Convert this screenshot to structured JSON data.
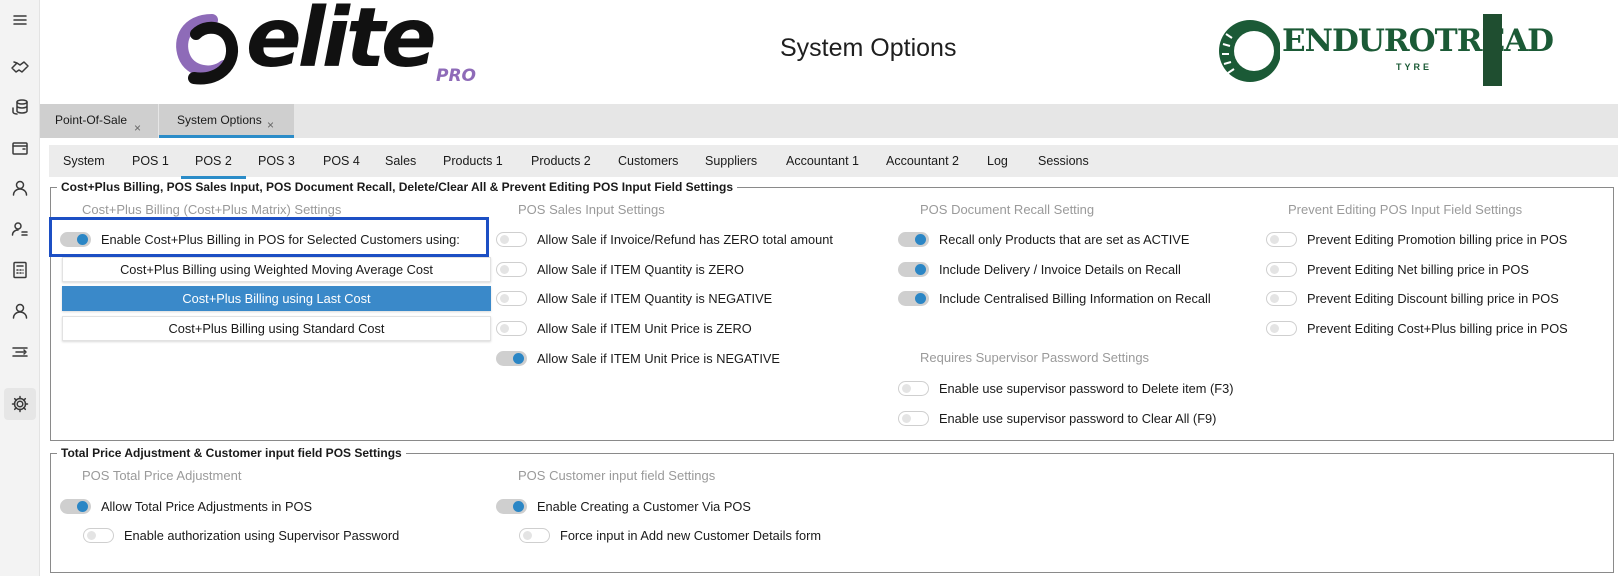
{
  "header": {
    "title": "System Options",
    "brand_left": {
      "word": "elite",
      "suffix": "PRO"
    },
    "brand_right": {
      "word": "ENDUROTREAD",
      "suffix": "TYRE"
    }
  },
  "rail": {
    "icons": [
      "menu-icon",
      "handshake-icon",
      "coins-icon",
      "wallet-icon",
      "user-icon",
      "user-group-icon",
      "calculator-icon",
      "person-icon",
      "transfer-icon",
      "gear-icon"
    ]
  },
  "doc_tabs": [
    {
      "label": "Point-Of-Sale",
      "close": "×",
      "active": false
    },
    {
      "label": "System Options",
      "close": "×",
      "active": true
    }
  ],
  "option_tabs": [
    "System",
    "POS 1",
    "POS 2",
    "POS 3",
    "POS 4",
    "Sales",
    "Products 1",
    "Products 2",
    "Customers",
    "Suppliers",
    "Accountant 1",
    "Accountant 2",
    "Log",
    "Sessions"
  ],
  "active_option_tab": "POS 2",
  "group1": {
    "legend": "Cost+Plus Billing, POS Sales Input, POS Document Recall, Delete/Clear All & Prevent Editing POS Input Field Settings",
    "costplus": {
      "heading": "Cost+Plus Billing (Cost+Plus Matrix) Settings",
      "toggle": {
        "label": "Enable Cost+Plus Billing in POS for Selected Customers using:",
        "on": true
      },
      "options": [
        {
          "label": "Cost+Plus Billing using Weighted Moving Average Cost",
          "selected": false
        },
        {
          "label": "Cost+Plus Billing using Last Cost",
          "selected": true
        },
        {
          "label": "Cost+Plus Billing using Standard Cost",
          "selected": false
        }
      ]
    },
    "sales_input": {
      "heading": "POS Sales Input Settings",
      "items": [
        {
          "label": "Allow Sale if Invoice/Refund has ZERO total amount",
          "on": false
        },
        {
          "label": "Allow Sale if ITEM Quantity is ZERO",
          "on": false
        },
        {
          "label": "Allow Sale if ITEM Quantity is NEGATIVE",
          "on": false
        },
        {
          "label": "Allow Sale if ITEM Unit Price is ZERO",
          "on": false
        },
        {
          "label": "Allow Sale if ITEM Unit Price is NEGATIVE",
          "on": true
        }
      ]
    },
    "recall": {
      "heading": "POS Document Recall Setting",
      "items": [
        {
          "label": "Recall only Products that are set as ACTIVE",
          "on": true
        },
        {
          "label": "Include Delivery / Invoice Details on Recall",
          "on": true
        },
        {
          "label": "Include Centralised Billing Information on Recall",
          "on": true
        }
      ]
    },
    "supervisor": {
      "heading": "Requires Supervisor Password Settings",
      "items": [
        {
          "label": "Enable use supervisor password to Delete item (F3)",
          "on": false
        },
        {
          "label": "Enable use supervisor password to Clear All (F9)",
          "on": false
        }
      ]
    },
    "prevent": {
      "heading": "Prevent Editing POS Input Field Settings",
      "items": [
        {
          "label": "Prevent Editing Promotion billing price in POS",
          "on": false
        },
        {
          "label": "Prevent Editing Net billing price in POS",
          "on": false
        },
        {
          "label": "Prevent Editing Discount billing price in POS",
          "on": false
        },
        {
          "label": "Prevent Editing Cost+Plus billing price in POS",
          "on": false
        }
      ]
    }
  },
  "group2": {
    "legend": "Total Price Adjustment & Customer input field POS Settings",
    "price_adj": {
      "heading": "POS Total Price Adjustment",
      "items": [
        {
          "label": "Allow Total Price Adjustments in POS",
          "on": true
        },
        {
          "label": "Enable authorization using Supervisor Password",
          "on": false
        }
      ]
    },
    "customer_input": {
      "heading": "POS Customer input field Settings",
      "items": [
        {
          "label": "Enable Creating a Customer Via POS",
          "on": true
        },
        {
          "label": "Force input in Add new Customer Details form",
          "on": false
        }
      ]
    }
  },
  "colors": {
    "accent": "#2b86c5",
    "highlight_border": "#1c4fc4",
    "brand_purple": "#8e6bb8",
    "brand_green": "#1b5a36"
  }
}
